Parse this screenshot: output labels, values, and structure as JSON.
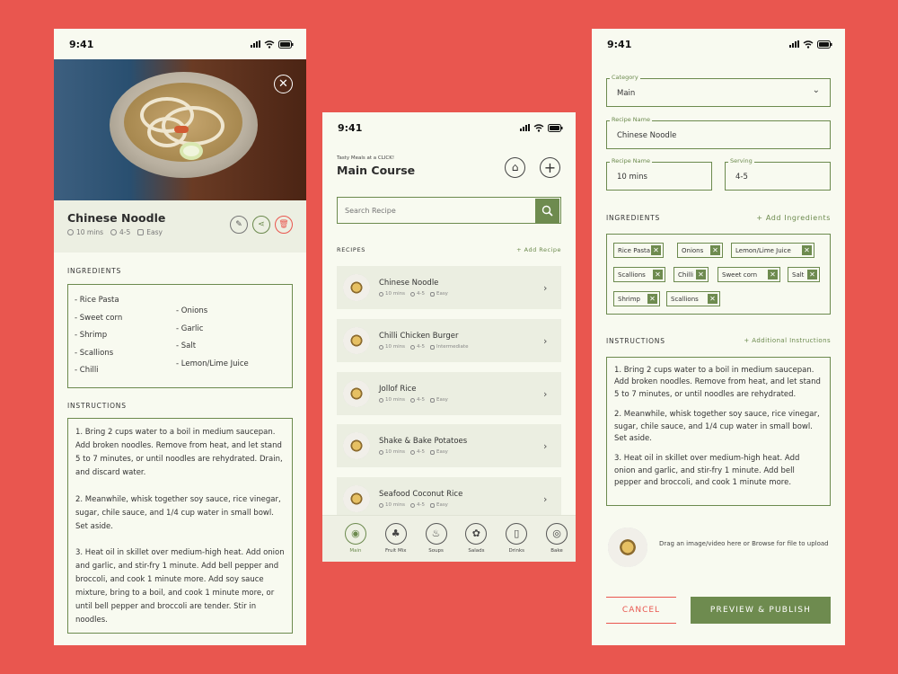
{
  "status": {
    "time": "9:41"
  },
  "detail": {
    "title": "Chinese Noodle",
    "time": "10 mins",
    "servings": "4-5",
    "difficulty": "Easy",
    "ingredients_label": "INGREDIENTS",
    "ingredients_col1": [
      "- Rice Pasta",
      "- Sweet corn",
      "- Shrimp",
      "- Scallions",
      "- Chilli"
    ],
    "ingredients_col2": [
      "- Onions",
      "- Garlic",
      "- Salt",
      "- Lemon/Lime Juice"
    ],
    "instructions_label": "INSTRUCTIONS",
    "instructions": [
      "1. Bring 2 cups water to a boil in medium saucepan. Add broken noodles. Remove from heat, and let stand 5 to 7 minutes, or until noodles are rehydrated. Drain, and discard water.",
      "2. Meanwhile, whisk together soy sauce, rice vinegar, sugar, chile sauce, and 1/4 cup water in small bowl. Set aside.",
      "3. Heat oil in skillet over medium-high heat. Add onion and garlic, and stir-fry 1 minute. Add bell pepper and broccoli, and cook 1 minute more. Add soy sauce mixture, bring to a boil, and cook 1 minute more, or until bell pepper and broccoli are tender. Stir in noodles."
    ]
  },
  "list": {
    "subtitle": "Tasty Meals at a CLICK!",
    "title": "Main Course",
    "search_placeholder": "Search Recipe",
    "recipes_label": "RECIPES",
    "add_recipe": "+ Add Recipe",
    "recipes": [
      {
        "name": "Chinese Noodle",
        "time": "10 mins",
        "serves": "4-5",
        "level": "Easy"
      },
      {
        "name": "Chilli Chicken Burger",
        "time": "10 mins",
        "serves": "4-5",
        "level": "Intermediate"
      },
      {
        "name": "Jollof Rice",
        "time": "10 mins",
        "serves": "4-5",
        "level": "Easy"
      },
      {
        "name": "Shake & Bake Potatoes",
        "time": "10 mins",
        "serves": "4-5",
        "level": "Easy"
      },
      {
        "name": "Seafood Coconut Rice",
        "time": "10 mins",
        "serves": "4-5",
        "level": "Easy"
      }
    ],
    "tabs": [
      "Main",
      "Fruit Mix",
      "Soups",
      "Salads",
      "Drinks",
      "Bake"
    ]
  },
  "form": {
    "category_label": "Category",
    "category_value": "Main",
    "name_label": "Recipe Name",
    "name_value": "Chinese Noodle",
    "time_label": "Recipe Name",
    "time_value": "10 mins",
    "serving_label": "Serving",
    "serving_value": "4-5",
    "ingredients_label": "INGREDIENTS",
    "add_ingredients": "+ Add Ingredients",
    "chips": [
      "Rice Pasta",
      "Onions",
      "Lemon/Lime Juice",
      "Scallions",
      "Chilli",
      "Sweet corn",
      "Salt",
      "Shrimp",
      "Scallions"
    ],
    "instructions_label": "INSTRUCTIONS",
    "add_instructions": "+ Additional Instructions",
    "instructions": [
      "1. Bring 2 cups water to a boil in medium saucepan. Add broken noodles. Remove from heat, and let stand 5 to 7 minutes, or until noodles are rehydrated.",
      "2. Meanwhile, whisk together soy sauce, rice vinegar, sugar, chile sauce, and 1/4 cup water in small bowl. Set aside.",
      "3. Heat oil in skillet over medium-high heat. Add onion and garlic, and stir-fry 1 minute. Add bell pepper and broccoli, and cook 1 minute more."
    ],
    "upload_text": "Drag an image/video here or Browse for file to upload",
    "cancel": "CANCEL",
    "publish": "PREVIEW & PUBLISH"
  },
  "colors": {
    "background": "#e9564f",
    "accent": "#6e8b4f",
    "danger": "#e9564f",
    "card": "#ebeee1"
  }
}
